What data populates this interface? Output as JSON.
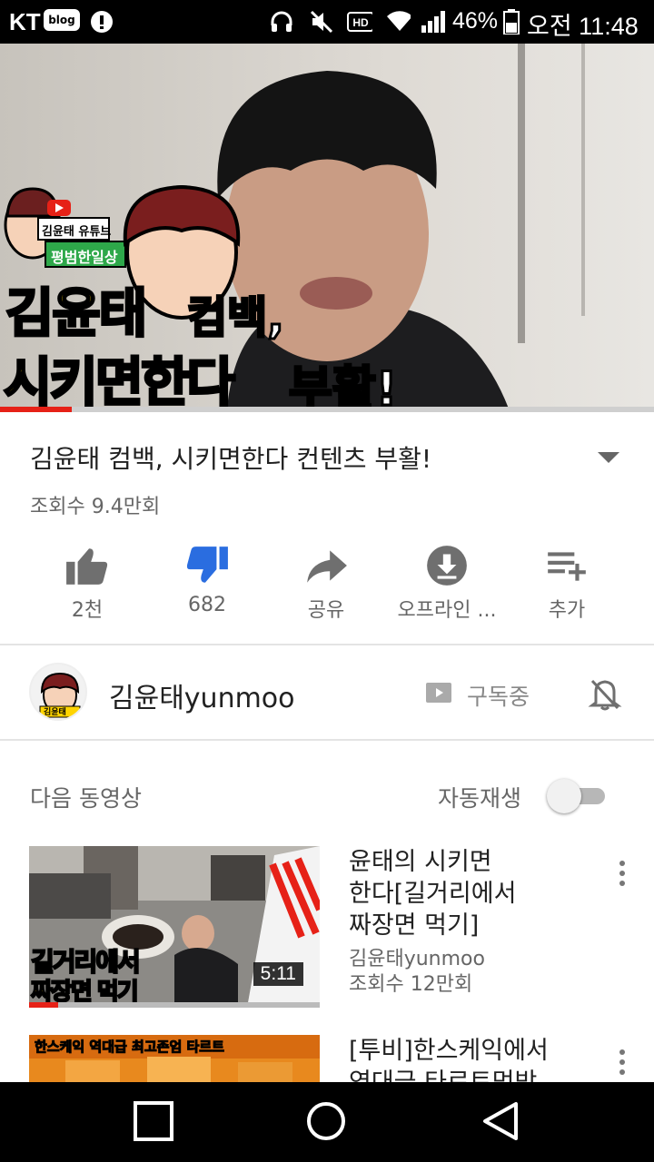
{
  "status_bar": {
    "carrier": "KT",
    "blog_badge": "blog",
    "battery_percent": "46%",
    "time": "오전 11:48",
    "icons": [
      "message-icon",
      "alert-icon",
      "headset-icon",
      "mute-icon",
      "hd-icon",
      "wifi-icon",
      "signal-icon",
      "battery-icon"
    ]
  },
  "player": {
    "overlay_channel_tag": "김윤태 유튜브",
    "overlay_series_tag": "평범한일상",
    "overlay_line1_a": "김윤태",
    "overlay_line1_b": "컴백,",
    "overlay_line2_a": "시키면한다",
    "overlay_line2_b": "부활!",
    "progress": 0.11
  },
  "video": {
    "title": "김윤태 컴백, 시키면한다 컨텐츠 부활!",
    "views": "조회수 9.4만회"
  },
  "actions": [
    {
      "name": "like",
      "label": "2천"
    },
    {
      "name": "dislike",
      "label": "682"
    },
    {
      "name": "share",
      "label": "공유"
    },
    {
      "name": "offline",
      "label": "오프라인 ..."
    },
    {
      "name": "add",
      "label": "추가"
    }
  ],
  "channel": {
    "name": "김윤태yunmoo",
    "avatar_text": "김윤태",
    "subscribe_label": "구독중"
  },
  "up_next": {
    "label": "다음 동영상",
    "autoplay_label": "자동재생",
    "autoplay_on": false
  },
  "videos": [
    {
      "title": "윤태의 시키면 한다[길거리에서 짜장면 먹기]",
      "title_lines": [
        "윤태의 시키면",
        "한다[길거리에서",
        "짜장면 먹기]"
      ],
      "channel": "김윤태yunmoo",
      "views": "조회수 12만회",
      "duration": "5:11",
      "thumb_text_1": "길거리에서",
      "thumb_text_2": "짜장면 먹기",
      "watched": 0.1
    },
    {
      "title_lines": [
        "[투비]한스케익에서",
        "역대급 타르트먹방"
      ],
      "thumb_text_1": "한스케익 역대급 최고존엄 타르트"
    }
  ],
  "colors": {
    "accent_red": "#e62117",
    "dislike_blue": "#2a6de0",
    "overlay_yellow": "#ffd400"
  }
}
